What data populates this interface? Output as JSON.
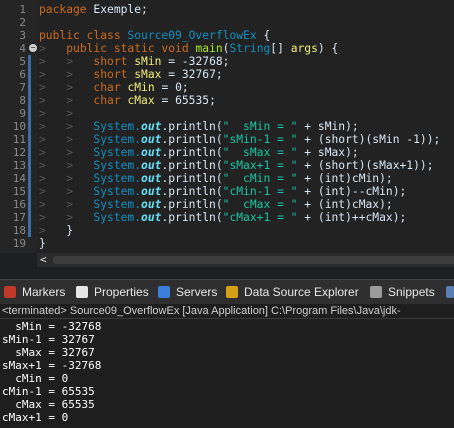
{
  "editor": {
    "line_numbers": [
      "1",
      "2",
      "3",
      "4",
      "5",
      "6",
      "7",
      "8",
      "9",
      "10",
      "11",
      "12",
      "13",
      "14",
      "15",
      "16",
      "17",
      "18",
      "19"
    ],
    "l1_pkg": "package",
    "l1_name": " Exemple;",
    "l3_public": "public",
    "l3_class": " class ",
    "l3_name": "Source09_OverflowEx",
    "l3_brace": " {",
    "l4_sig_a": "public static void ",
    "l4_main": "main",
    "l4_paren": "(",
    "l4_string": "String",
    "l4_args_a": "[] ",
    "l4_args": "args",
    "l4_end": ") {",
    "l5_type": "short",
    "l5_var": "sMin",
    "l5_rest": " = ",
    "l5_val": "-32768;",
    "l6_type": "short",
    "l6_var": "sMax",
    "l6_rest": " = ",
    "l6_val": "32767;",
    "l7_type": "char",
    "l7_var": "cMin",
    "l7_rest": " = ",
    "l7_val": "0;",
    "l8_type": "char",
    "l8_var": "cMax",
    "l8_rest": " = ",
    "l8_val": "65535;",
    "print_lines": [
      {
        "str": "\"  sMin = \"",
        "tail": " + sMin);"
      },
      {
        "str": "\"sMin-1 = \"",
        "tail": " + (short)(sMin -1));"
      },
      {
        "str": "\"  sMax = \"",
        "tail": " + sMax);"
      },
      {
        "str": "\"sMax+1 = \"",
        "tail": " + (short)(sMax+1));"
      },
      {
        "str": "\"  cMin = \"",
        "tail": " + (int)cMin);"
      },
      {
        "str": "\"cMin-1 = \"",
        "tail": " + (int)--cMin);"
      },
      {
        "str": "\"  cMax = \"",
        "tail": " + (int)cMax);"
      },
      {
        "str": "\"cMax+1 = \"",
        "tail": " + (int)++cMax);"
      }
    ],
    "sys": "System.",
    "out": "out",
    "println": ".println(",
    "close_inner": "}",
    "close_outer": "}",
    "scroll_left": "<"
  },
  "tabs": {
    "markers": "Markers",
    "properties": "Properties",
    "servers": "Servers",
    "dse": "Data Source Explorer",
    "snippets": "Snippets"
  },
  "console": {
    "header": "<terminated> Source09_OverflowEx [Java Application] C:\\Program Files\\Java\\jdk-",
    "lines": [
      "  sMin = -32768",
      "sMin-1 = 32767",
      "  sMax = 32767",
      "sMax+1 = -32768",
      "  cMin = 0",
      "cMin-1 = 65535",
      "  cMax = 65535",
      "cMax+1 = 0"
    ]
  },
  "colors": {
    "keyword": "#cc6c1d",
    "string": "#17c6a3",
    "method": "#a7ec21",
    "field": "#66e1f8"
  }
}
